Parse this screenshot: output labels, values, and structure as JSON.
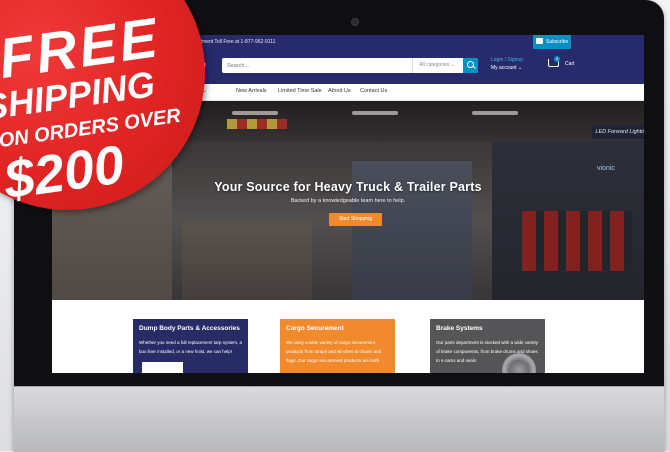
{
  "site": {
    "topbar": {
      "phone_text": "Department Toll Free at 1-877-962-9111",
      "subscribe_label": "Subscribe"
    },
    "header": {
      "logo_fragment": "ch",
      "search_placeholder": "Search...",
      "search_category": "All categories",
      "login_label": "Login / Signup",
      "account_label": "My account",
      "cart_label": "Cart",
      "cart_count": "0"
    },
    "nav": {
      "items": [
        "ory",
        "New Arrivals",
        "Limited Time Sale",
        "About Us",
        "Contact Us"
      ]
    },
    "hero": {
      "title": "Your Source for Heavy Truck & Trailer Parts",
      "subtitle": "Backed by a knowledgeable team here to help.",
      "button_label": "Start Shopping",
      "sign_text": "LED Forward Lighting",
      "brand_text": "vionic"
    },
    "categories": [
      {
        "title": "Dump Body Parts & Accessories",
        "desc": "Whether you need a full replacement tarp system, a box liner installed, or a new hoist, we can help!"
      },
      {
        "title": "Cargo Securement",
        "desc": "We carry a wide variety of cargo securement products from straps and winches to chains and flags. Our cargo securement products are both"
      },
      {
        "title": "Brake Systems",
        "desc": "Our parts department is stocked with a wide variety of brake components, from brake drums and shoes to s-cams and seals."
      }
    ]
  },
  "badge": {
    "line1": "FREE",
    "line2": "SHIPPING",
    "line3": "ON ORDERS OVER",
    "line4": "$200"
  },
  "colors": {
    "navy": "#272b6c",
    "accent_blue": "#0a8fc4",
    "orange": "#f08a2c",
    "badge_red": "#e02323"
  }
}
